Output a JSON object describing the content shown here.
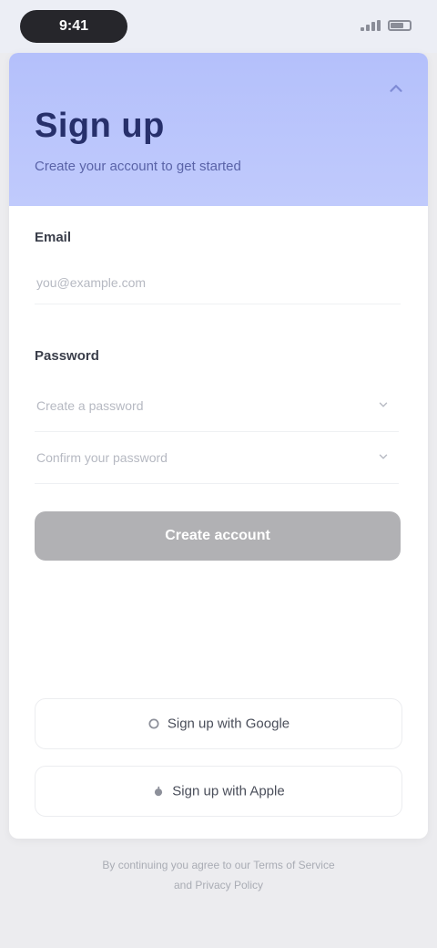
{
  "status_bar": {
    "time": "9:41"
  },
  "header": {
    "title": "Sign up",
    "subtitle": "Create your account to get started"
  },
  "form": {
    "email": {
      "label": "Email",
      "placeholder": "you@example.com",
      "value": ""
    },
    "password": {
      "label": "Password",
      "placeholder": "Create a password",
      "confirm_placeholder": "Confirm your password"
    },
    "submit_label": "Create account"
  },
  "alt_signin": {
    "google_label": "Sign up with Google",
    "apple_label": "Sign up with Apple"
  },
  "footer": {
    "line1": "By continuing you agree to our Terms of Service",
    "line2": "and Privacy Policy"
  },
  "colors": {
    "header_bg": "#b4c0fb",
    "title": "#27306b",
    "primary_button_disabled": "#b1b1b4"
  },
  "icons": {
    "header": "chevron-up-icon",
    "select": "chevron-down-icon",
    "google": "google-icon",
    "apple": "apple-icon"
  }
}
